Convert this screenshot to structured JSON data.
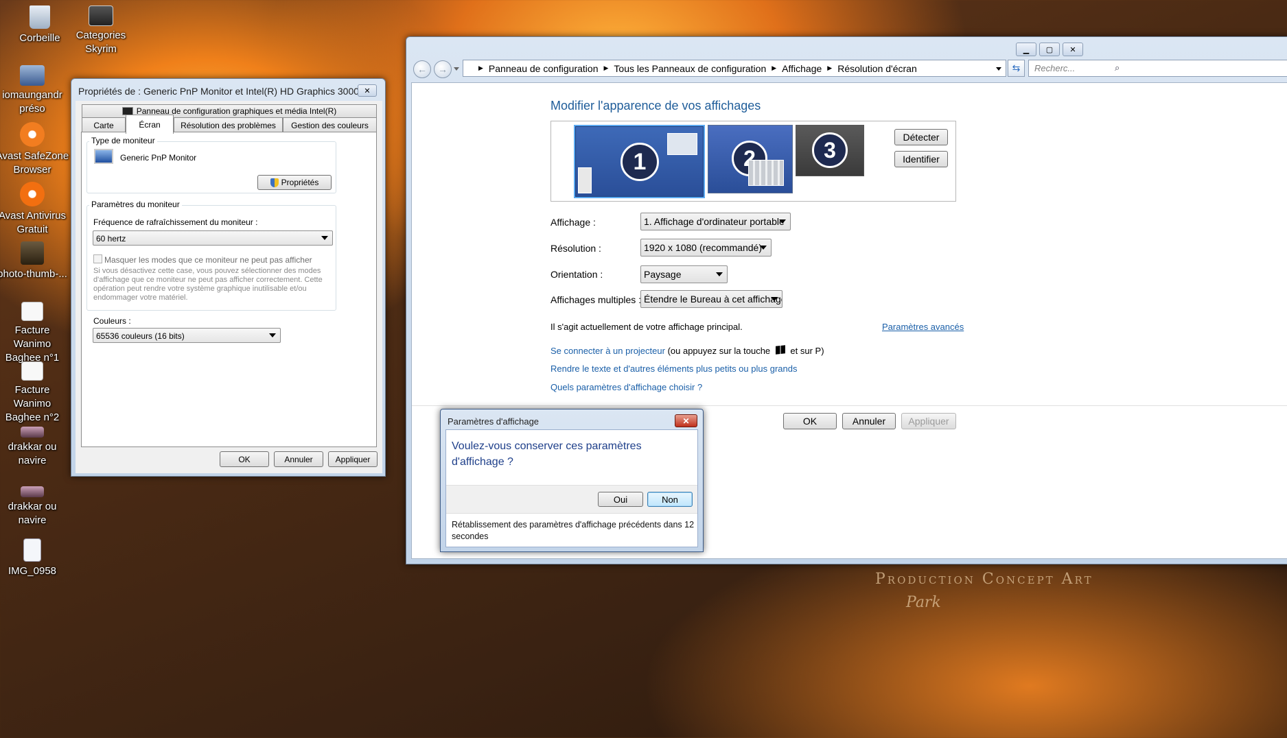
{
  "desktop": {
    "icons": [
      {
        "label": "Corbeille",
        "icon": "recycle-bin-icon"
      },
      {
        "label": "Categories Skyrim",
        "icon": "folder-icon"
      },
      {
        "label": "iomaungandr préso",
        "icon": "presentation-icon"
      },
      {
        "label": "Avast SafeZone Browser",
        "icon": "avast-safezone-icon"
      },
      {
        "label": "Avast Antivirus Gratuit",
        "icon": "avast-antivirus-icon"
      },
      {
        "label": "photo-thumb-...",
        "icon": "photo-icon"
      },
      {
        "label": "Facture Wanimo Baghee n°1",
        "icon": "document-icon"
      },
      {
        "label": "Facture Wanimo Baghee n°2",
        "icon": "document-icon"
      },
      {
        "label": "drakkar ou navire",
        "icon": "image-icon"
      },
      {
        "label": "drakkar ou navire",
        "icon": "image-icon"
      },
      {
        "label": "IMG_0958",
        "icon": "document-icon"
      }
    ],
    "watermark_text": "Production Concept Art",
    "watermark_signature": "Park"
  },
  "props_dialog": {
    "title": "Propriétés de : Generic PnP Monitor et Intel(R) HD Graphics 3000",
    "top_tab": "Panneau de configuration graphiques et média Intel(R)",
    "tabs": [
      "Carte",
      "Écran",
      "Résolution des problèmes",
      "Gestion des couleurs"
    ],
    "active_tab": "Écran",
    "monitor_type_group": "Type de moniteur",
    "monitor_name": "Generic PnP Monitor",
    "properties_button": "Propriétés",
    "monitor_settings_group": "Paramètres du moniteur",
    "refresh_label": "Fréquence de rafraîchissement du moniteur :",
    "refresh_value": "60 hertz",
    "hide_modes_label": "Masquer les modes que ce moniteur ne peut pas afficher",
    "hide_modes_help": "Si vous désactivez cette case, vous pouvez sélectionner des modes d'affichage que ce moniteur ne peut pas afficher correctement. Cette opération peut rendre votre système graphique inutilisable et/ou endommager votre matériel.",
    "colors_label": "Couleurs :",
    "colors_value": "65536 couleurs (16 bits)",
    "ok": "OK",
    "cancel": "Annuler",
    "apply": "Appliquer"
  },
  "control_panel": {
    "breadcrumb": [
      "Panneau de configuration",
      "Tous les Panneaux de configuration",
      "Affichage",
      "Résolution d'écran"
    ],
    "search_placeholder": "Recherc...",
    "heading": "Modifier l'apparence de vos affichages",
    "monitors": [
      "1",
      "2",
      "3"
    ],
    "detect_button": "Détecter",
    "identify_button": "Identifier",
    "display_label": "Affichage :",
    "display_value": "1. Affichage d'ordinateur portable",
    "resolution_label": "Résolution :",
    "resolution_value": "1920 x 1080 (recommandé)",
    "orientation_label": "Orientation :",
    "orientation_value": "Paysage",
    "multiple_label": "Affichages multiples :",
    "multiple_value": "Étendre le Bureau à cet affichage",
    "primary_text": "Il s'agit actuellement de votre affichage principal.",
    "advanced_link": "Paramètres avancés",
    "projector_link": "Se connecter à un projecteur",
    "projector_suffix_1": "(ou appuyez sur la touche",
    "projector_suffix_2": "et sur P)",
    "text_size_link": "Rendre le texte et d'autres éléments plus petits ou plus grands",
    "which_settings_link": "Quels paramètres d'affichage choisir ?",
    "ok": "OK",
    "cancel": "Annuler",
    "apply": "Appliquer",
    "accent_color": "#1e5c99"
  },
  "confirm_dialog": {
    "title": "Paramètres d'affichage",
    "question": "Voulez-vous conserver ces paramètres d'affichage ?",
    "yes": "Oui",
    "no": "Non",
    "countdown_text": "Rétablissement des paramètres d'affichage précédents dans 12 secondes"
  }
}
